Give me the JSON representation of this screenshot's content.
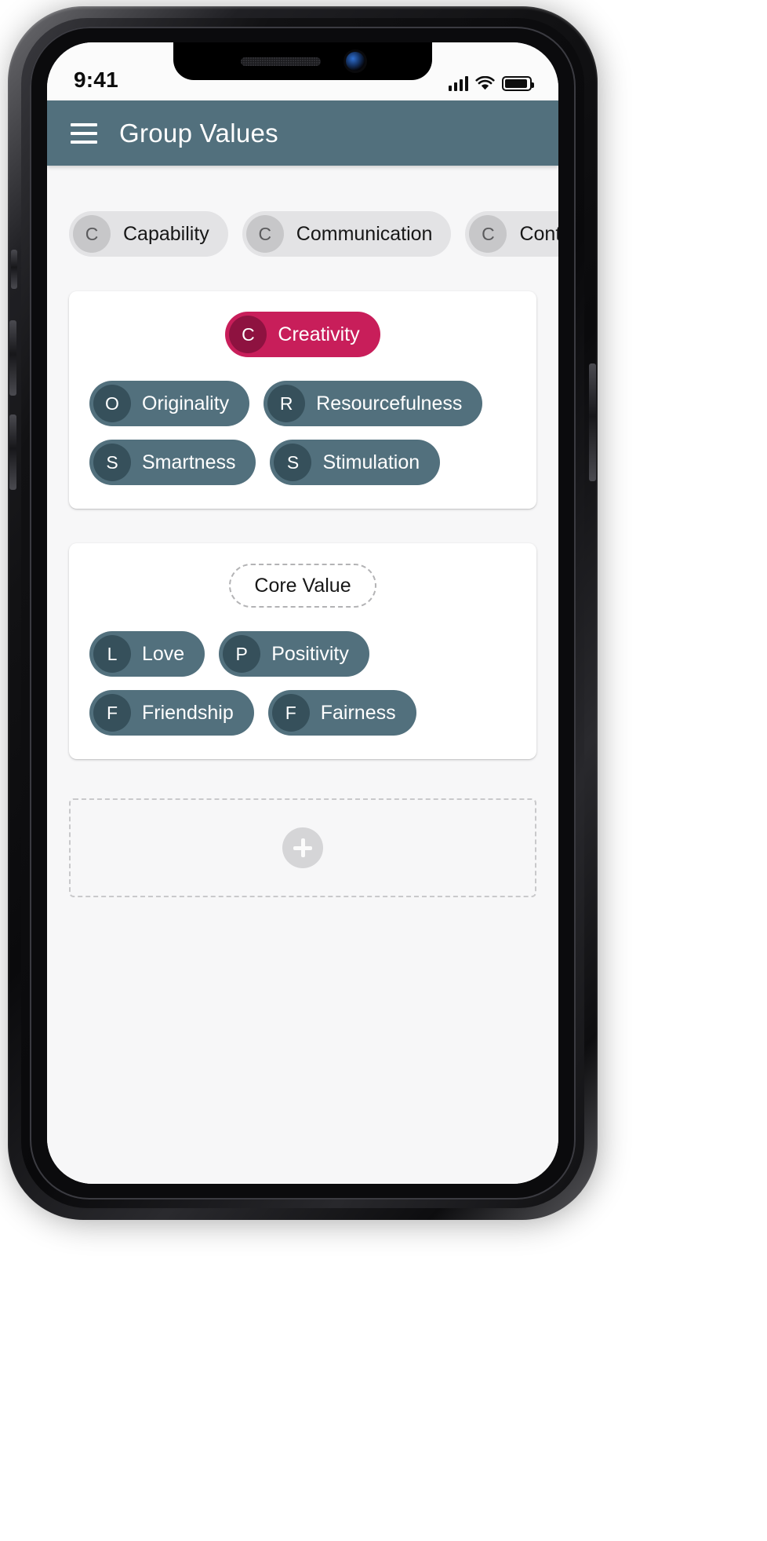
{
  "statusbar": {
    "time": "9:41",
    "signal_icon": "cellular-signal-icon",
    "wifi_icon": "wifi-icon",
    "battery_icon": "battery-full-icon"
  },
  "appbar": {
    "menu_icon": "hamburger-menu-icon",
    "title": "Group Values"
  },
  "filters": [
    {
      "initial": "C",
      "label": "Capability"
    },
    {
      "initial": "C",
      "label": "Communication"
    },
    {
      "initial": "C",
      "label": "Continuous"
    }
  ],
  "cards": [
    {
      "header": {
        "initial": "C",
        "label": "Creativity",
        "style": "accent"
      },
      "values": [
        {
          "initial": "O",
          "label": "Originality"
        },
        {
          "initial": "R",
          "label": "Resourcefulness"
        },
        {
          "initial": "S",
          "label": "Smartness"
        },
        {
          "initial": "S",
          "label": "Stimulation"
        }
      ]
    },
    {
      "header": {
        "label": "Core Value",
        "style": "dashed"
      },
      "values": [
        {
          "initial": "L",
          "label": "Love"
        },
        {
          "initial": "P",
          "label": "Positivity"
        },
        {
          "initial": "F",
          "label": "Friendship"
        },
        {
          "initial": "F",
          "label": "Fairness"
        }
      ]
    }
  ],
  "add_card": {
    "icon": "plus-icon"
  },
  "colors": {
    "appbar": "#52707d",
    "accent": "#c81e5a",
    "accent_dark": "#8e1240",
    "slate": "#52707d",
    "slate_dark": "#36505b",
    "page_background": "#f7f7f8",
    "card_background": "#ffffff",
    "filter_chip": "#e3e3e5"
  }
}
